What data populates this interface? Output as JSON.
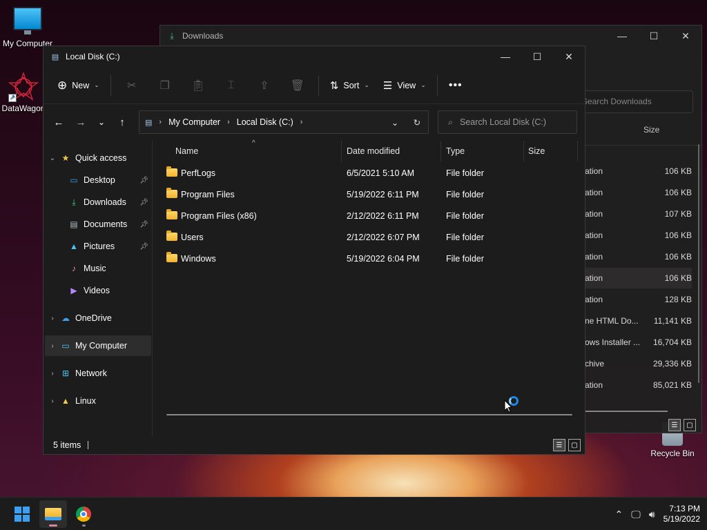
{
  "desktop": {
    "icons": [
      {
        "label": "My Computer"
      },
      {
        "label": "DataWagon"
      },
      {
        "label": "Recycle Bin"
      }
    ]
  },
  "downloads_window": {
    "title": "Downloads",
    "search_placeholder": "Search Downloads",
    "size_header": "Size",
    "rows": [
      {
        "type": "ation",
        "size": "106 KB"
      },
      {
        "type": "ation",
        "size": "106 KB"
      },
      {
        "type": "ation",
        "size": "107 KB"
      },
      {
        "type": "ation",
        "size": "106 KB"
      },
      {
        "type": "ation",
        "size": "106 KB"
      },
      {
        "type": "ation",
        "size": "106 KB"
      },
      {
        "type": "ation",
        "size": "128 KB"
      },
      {
        "type": "ne HTML Do...",
        "size": "11,141 KB"
      },
      {
        "type": "ows Installer ...",
        "size": "16,704 KB"
      },
      {
        "type": "chive",
        "size": "29,336 KB"
      },
      {
        "type": "ation",
        "size": "85,021 KB"
      }
    ]
  },
  "explorer": {
    "title": "Local Disk (C:)",
    "toolbar": {
      "new_label": "New",
      "sort_label": "Sort",
      "view_label": "View",
      "more_label": "•••"
    },
    "address": {
      "crumbs": [
        "My Computer",
        "Local Disk (C:)"
      ]
    },
    "search_placeholder": "Search Local Disk (C:)",
    "nav": {
      "quick_access": "Quick access",
      "pinned": [
        {
          "label": "Desktop",
          "icon": "desktop-icon"
        },
        {
          "label": "Downloads",
          "icon": "download-icon"
        },
        {
          "label": "Documents",
          "icon": "documents-icon"
        },
        {
          "label": "Pictures",
          "icon": "pictures-icon"
        },
        {
          "label": "Music",
          "icon": "music-icon"
        },
        {
          "label": "Videos",
          "icon": "videos-icon"
        }
      ],
      "onedrive": "OneDrive",
      "my_computer": "My Computer",
      "network": "Network",
      "linux": "Linux"
    },
    "columns": {
      "name": "Name",
      "date": "Date modified",
      "type": "Type",
      "size": "Size"
    },
    "files": [
      {
        "name": "PerfLogs",
        "date": "6/5/2021 5:10 AM",
        "type": "File folder",
        "size": ""
      },
      {
        "name": "Program Files",
        "date": "5/19/2022 6:11 PM",
        "type": "File folder",
        "size": ""
      },
      {
        "name": "Program Files (x86)",
        "date": "2/12/2022 6:11 PM",
        "type": "File folder",
        "size": ""
      },
      {
        "name": "Users",
        "date": "2/12/2022 6:07 PM",
        "type": "File folder",
        "size": ""
      },
      {
        "name": "Windows",
        "date": "5/19/2022 6:04 PM",
        "type": "File folder",
        "size": ""
      }
    ],
    "status": "5 items"
  },
  "taskbar": {
    "time": "7:13 PM",
    "date": "5/19/2022"
  },
  "colors": {
    "accent": "#3ba0f2",
    "folder": "#f2b330",
    "window_bg": "#1c1c1c"
  }
}
